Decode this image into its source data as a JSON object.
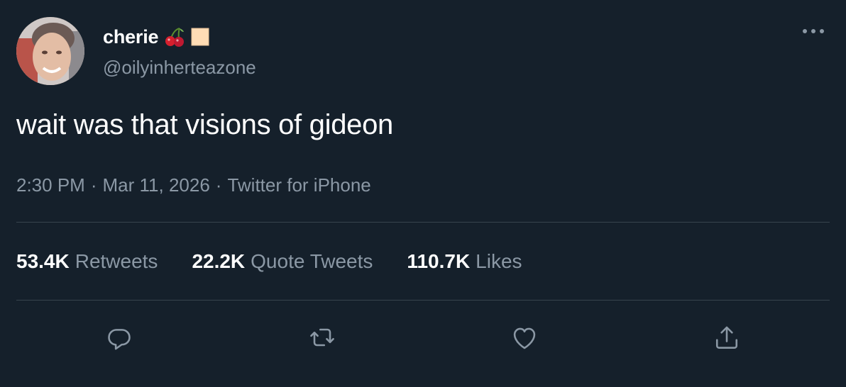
{
  "user": {
    "display_name": "cherie",
    "handle": "@oilyinherteazone",
    "name_emojis": [
      "cherries-emoji",
      "skin-tone-square-emoji"
    ]
  },
  "tweet": {
    "text": "wait was that visions of gideon",
    "time": "2:30 PM",
    "separator": "·",
    "date": "Mar 11, 2026",
    "source": "Twitter for iPhone"
  },
  "stats": {
    "retweets_count": "53.4K",
    "retweets_label": "Retweets",
    "quotes_count": "22.2K",
    "quotes_label": "Quote Tweets",
    "likes_count": "110.7K",
    "likes_label": "Likes"
  },
  "actions": [
    "reply-icon",
    "retweet-icon",
    "like-icon",
    "share-icon"
  ],
  "colors": {
    "background": "#15202b",
    "text_primary": "#ffffff",
    "text_secondary": "#8b98a5",
    "divider": "#38444d",
    "icon": "#8b98a5"
  }
}
